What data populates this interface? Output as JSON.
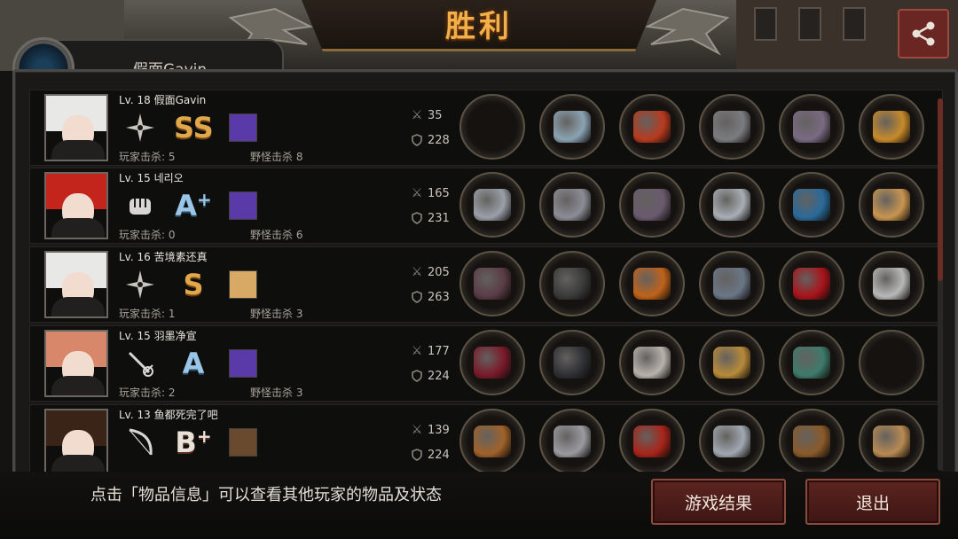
{
  "header": {
    "title": "胜利"
  },
  "top_player": {
    "name": "假面Gavin"
  },
  "players": [
    {
      "level": "Lv. 18 假面Gavin",
      "weapon": "shuriken-icon",
      "grade": "SS",
      "grade_plus": "",
      "skill_color": "#5a3aa8",
      "player_kills": "玩家击杀: 5",
      "monster_kills": "野怪击杀 8",
      "attack": "35",
      "defense": "228",
      "hair": "#e8e8e6",
      "items": [
        {
          "color": "#0f0f0f"
        },
        {
          "color": "#8ba3b3"
        },
        {
          "color": "#b83a1e"
        },
        {
          "color": "#7b7c80"
        },
        {
          "color": "#7a6a82"
        },
        {
          "color": "#c78a2a"
        }
      ]
    },
    {
      "level": "Lv. 15 네리오",
      "weapon": "fist-icon",
      "grade": "A",
      "grade_plus": "+",
      "skill_color": "#5a3aa8",
      "player_kills": "玩家击杀: 0",
      "monster_kills": "野怪击杀 6",
      "attack": "165",
      "defense": "231",
      "hair": "#c3241c",
      "items": [
        {
          "color": "#9aa0a8"
        },
        {
          "color": "#8c8c96"
        },
        {
          "color": "#6a5a6e"
        },
        {
          "color": "#a8aeb4"
        },
        {
          "color": "#2a6a9a"
        },
        {
          "color": "#c99550"
        }
      ]
    },
    {
      "level": "Lv. 16 苦境素还真",
      "weapon": "shuriken-icon",
      "grade": "S",
      "grade_plus": "",
      "skill_color": "#d8a964",
      "player_kills": "玩家击杀: 1",
      "monster_kills": "野怪击杀 3",
      "attack": "205",
      "defense": "263",
      "hair": "#e8e8e6",
      "items": [
        {
          "color": "#5a3c46"
        },
        {
          "color": "#3a3a3a"
        },
        {
          "color": "#c0621a"
        },
        {
          "color": "#6a7686"
        },
        {
          "color": "#a8141a"
        },
        {
          "color": "#b8b8b8"
        }
      ]
    },
    {
      "level": "Lv. 15 羽墨净宣",
      "weapon": "rapier-icon",
      "grade": "A",
      "grade_plus": "",
      "skill_color": "#5a3aa8",
      "player_kills": "玩家击杀: 2",
      "monster_kills": "野怪击杀 3",
      "attack": "177",
      "defense": "224",
      "hair": "#d8876a",
      "items": [
        {
          "color": "#7a1a2a"
        },
        {
          "color": "#2e3034"
        },
        {
          "color": "#b8b2ac"
        },
        {
          "color": "#b88a3a"
        },
        {
          "color": "#3e7a6a"
        },
        {
          "color": "#0f0f0f"
        }
      ]
    },
    {
      "level": "Lv. 13 鱼都死完了吧",
      "weapon": "bow-icon",
      "grade": "B",
      "grade_plus": "+",
      "skill_color": "#6a4a2e",
      "player_kills": "",
      "monster_kills": "",
      "attack": "139",
      "defense": "224",
      "hair": "#3a2418",
      "items": [
        {
          "color": "#a0622a"
        },
        {
          "color": "#9a9aa0"
        },
        {
          "color": "#a8241a"
        },
        {
          "color": "#a0a8b0"
        },
        {
          "color": "#8a5a2a"
        },
        {
          "color": "#b88a52"
        }
      ]
    }
  ],
  "footer": {
    "hint": "点击「物品信息」可以查看其他玩家的物品及状态",
    "result_button": "游戏结果",
    "exit_button": "退出"
  },
  "colors": {
    "accent": "#f3b04a",
    "button": "#5c2420"
  }
}
